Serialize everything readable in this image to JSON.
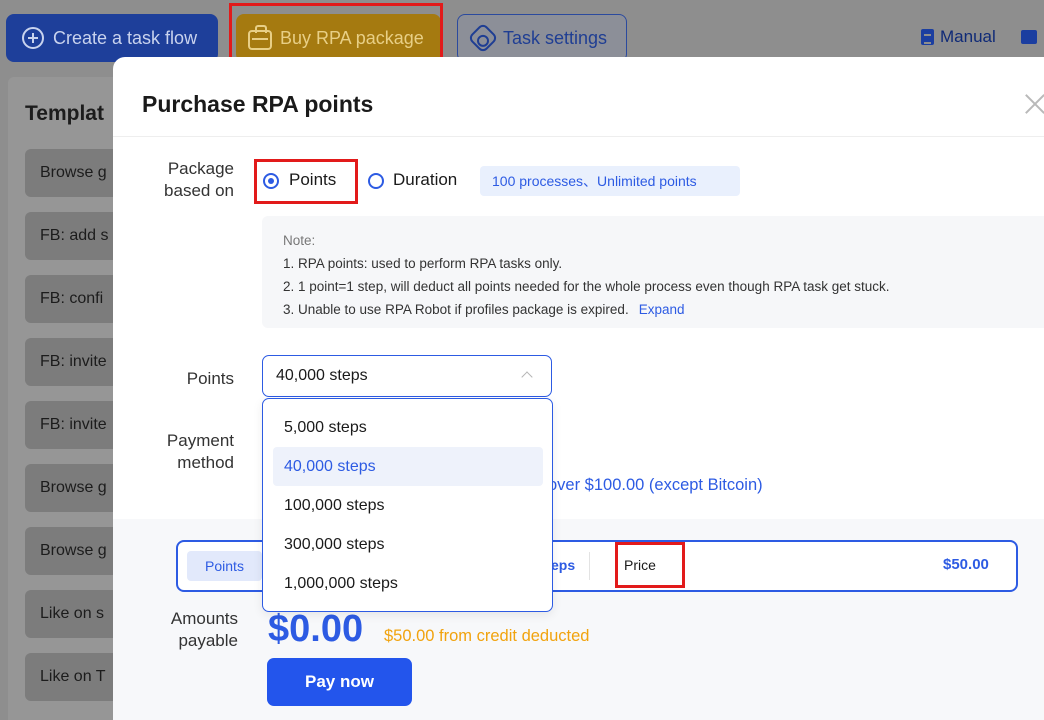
{
  "toolbar": {
    "create_label": "Create a task flow",
    "buy_label": "Buy RPA package",
    "settings_label": "Task settings",
    "manual_label": "Manual"
  },
  "templates": {
    "title": "Templat",
    "items": [
      "Browse g",
      "FB: add s",
      "FB: confi",
      "FB: invite",
      "FB: invite",
      "Browse g",
      "Browse g",
      "Like on s",
      "Like on T"
    ]
  },
  "modal": {
    "title": "Purchase RPA points",
    "package_label_line1": "Package",
    "package_label_line2": "based on",
    "option_points": "Points",
    "option_duration": "Duration",
    "duration_tag": "100 processes、Unlimited points",
    "note": {
      "title": "Note:",
      "line1": "1. RPA points: used to perform RPA tasks only.",
      "line2": "2. 1 point=1 step, will deduct all points needed for the whole process even though RPA task get stuck.",
      "line3": "3. Unable to use RPA Robot if profiles package is expired.",
      "expand_link": "Expand"
    },
    "points_label": "Points",
    "points_selected": "40,000 steps",
    "points_options": [
      "5,000 steps",
      "40,000 steps",
      "100,000 steps",
      "300,000 steps",
      "1,000,000 steps"
    ],
    "payment_label_line1": "Payment",
    "payment_label_line2": "method",
    "discount_text": "over $100.00 (except Bitcoin)",
    "summary": {
      "points_chip": "Points",
      "steps_fragment": "eps",
      "price_label": "Price",
      "price_value": "$50.00"
    },
    "amount_label_line1": "Amounts",
    "amount_label_line2": "payable",
    "amount_value": "$0.00",
    "credit_text": "$50.00 from credit deducted",
    "pay_button": "Pay now"
  },
  "colors": {
    "accent": "#2d5be3",
    "highlight_red": "#e21a1a",
    "credit_orange": "#f1a30e"
  }
}
